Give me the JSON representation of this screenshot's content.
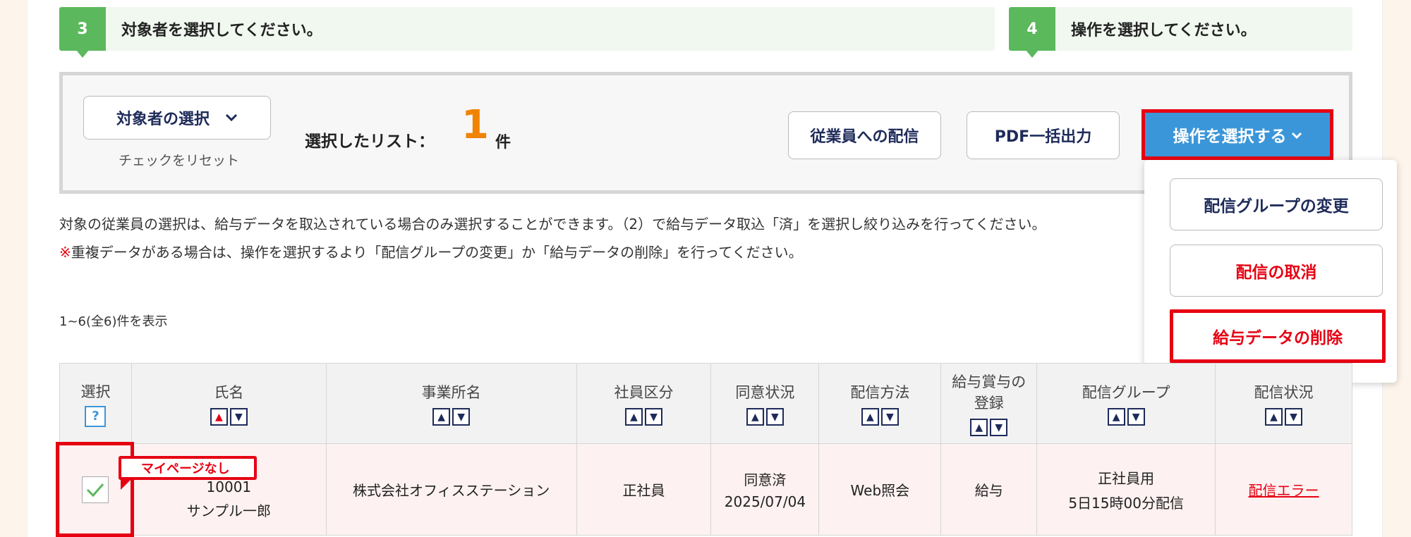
{
  "steps": [
    {
      "number": "3",
      "text": "対象者を選択してください。"
    },
    {
      "number": "4",
      "text": "操作を選択してください。"
    }
  ],
  "selection": {
    "target_button": "対象者の選択",
    "reset_link": "チェックをリセット",
    "selected_label": "選択したリスト：",
    "selected_count": "1",
    "count_unit": "件"
  },
  "actions": {
    "deliver_button": "従業員への配信",
    "pdf_button": "PDF一括出力",
    "operation_button": "操作を選択する"
  },
  "dropdown": {
    "items": [
      "配信グループの変更",
      "配信の取消",
      "給与データの削除"
    ]
  },
  "notes": {
    "line1": "対象の従業員の選択は、給与データを取込されている場合のみ選択することができます。（2）で給与データ取込「済」を選択し絞り込みを行ってください。",
    "mark": "※",
    "line2": "重複データがある場合は、操作を選択するより「配信グループの変更」か「給与データの削除」を行ってください。"
  },
  "list_count": "1~6(全6)件を表示",
  "table": {
    "headers": {
      "select": "選択",
      "name": "氏名",
      "office": "事業所名",
      "type": "社員区分",
      "consent": "同意状況",
      "method": "配信方法",
      "reg_line1": "給与賞与の",
      "reg_line2": "登録",
      "group": "配信グループ",
      "status": "配信状況"
    },
    "help_label": "?",
    "row": {
      "badge": "マイページなし",
      "id": "10001",
      "name": "サンプル一郎",
      "office": "株式会社オフィスステーション",
      "type": "正社員",
      "consent": "同意済",
      "consent_date": "2025/07/04",
      "method": "Web照会",
      "registration": "給与",
      "group": "正社員用",
      "group_schedule": "5日15時00分配信",
      "status": "配信エラー"
    }
  },
  "colors": {
    "accent_green": "#5cb85c",
    "primary_blue": "#3b96d9",
    "highlight_red": "#e60012",
    "navy_text": "#1e2b5a"
  }
}
